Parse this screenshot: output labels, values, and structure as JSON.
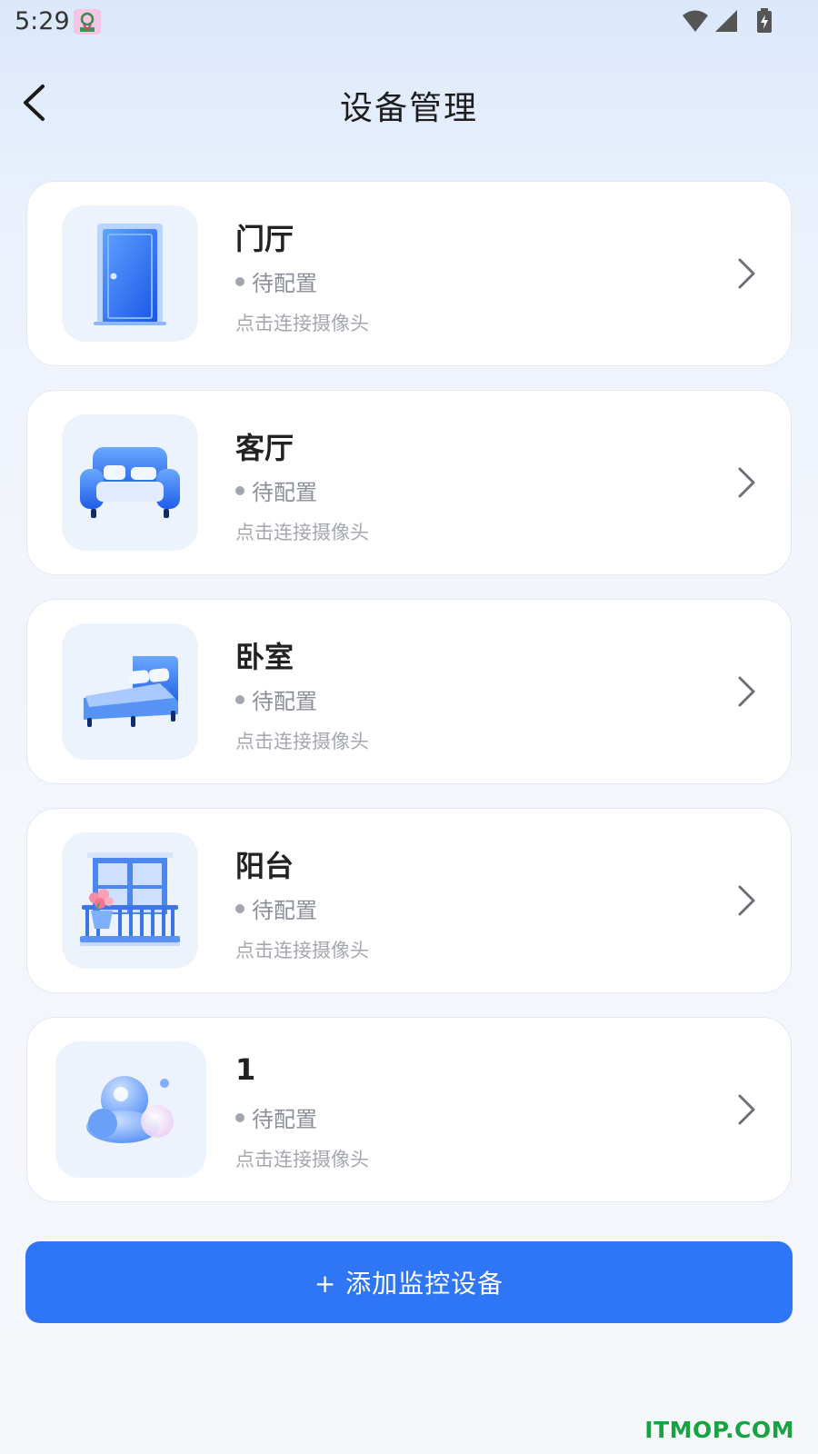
{
  "status_bar": {
    "time": "5:29",
    "icons": [
      "app-notification-icon",
      "wifi-icon",
      "signal-icon",
      "battery-charging-icon"
    ]
  },
  "nav": {
    "title": "设备管理",
    "back_icon": "chevron-left-icon"
  },
  "devices": [
    {
      "name": "门厅",
      "status": "待配置",
      "hint": "点击连接摄像头",
      "icon": "door-icon"
    },
    {
      "name": "客厅",
      "status": "待配置",
      "hint": "点击连接摄像头",
      "icon": "sofa-icon"
    },
    {
      "name": "卧室",
      "status": "待配置",
      "hint": "点击连接摄像头",
      "icon": "bed-icon"
    },
    {
      "name": "阳台",
      "status": "待配置",
      "hint": "点击连接摄像头",
      "icon": "balcony-icon"
    },
    {
      "name": "1",
      "status": "待配置",
      "hint": "点击连接摄像头",
      "icon": "cloud-icon"
    }
  ],
  "add_button": {
    "label": "+ 添加监控设备"
  },
  "watermark": "ITMOP.COM",
  "colors": {
    "primary": "#2e76f6",
    "thumb_bg": "#edf3fd",
    "status_gray": "#8b8f97",
    "watermark_green": "#18a342"
  }
}
